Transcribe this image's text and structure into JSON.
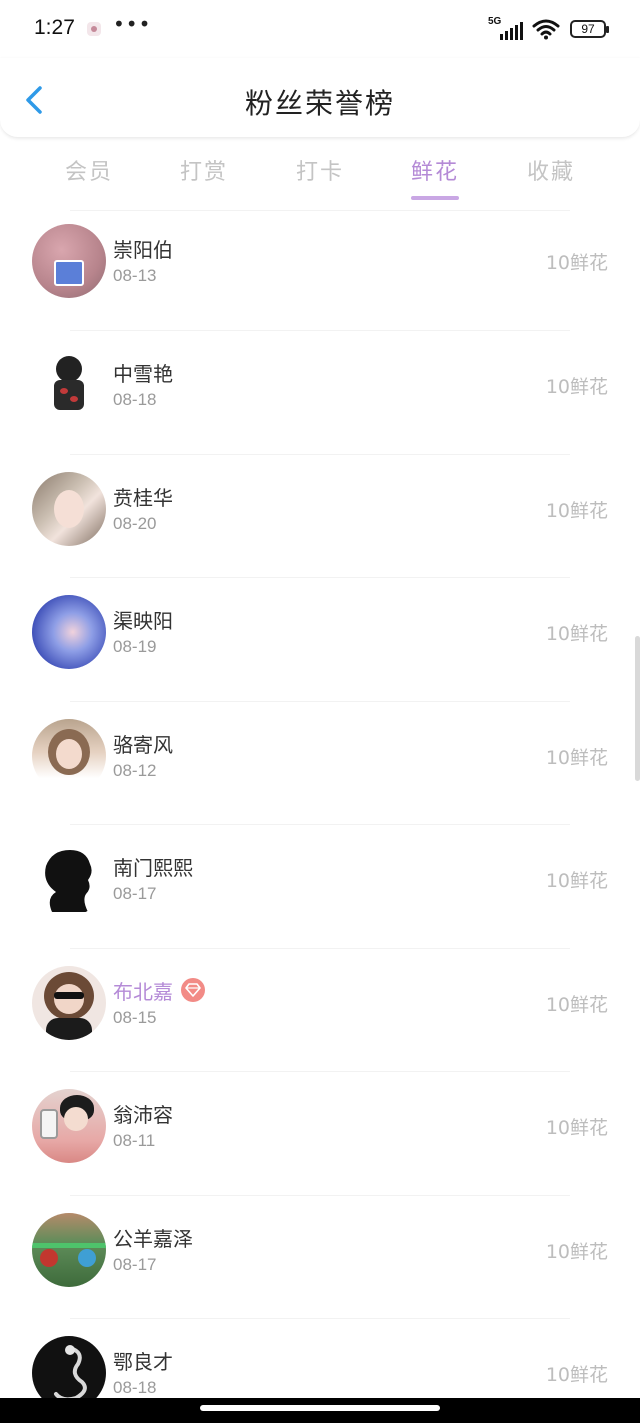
{
  "status_bar": {
    "time": "1:27",
    "dots": "•••",
    "network": "5G",
    "battery": "97"
  },
  "header": {
    "title": "粉丝荣誉榜",
    "back_icon": "chevron-left-icon"
  },
  "tabs": [
    {
      "label": "会员",
      "active": false
    },
    {
      "label": "打赏",
      "active": false
    },
    {
      "label": "打卡",
      "active": false
    },
    {
      "label": "鲜花",
      "active": true
    },
    {
      "label": "收藏",
      "active": false
    }
  ],
  "colors": {
    "accent": "#b48ad6",
    "back_icon": "#2f9ae8",
    "vip_badge": "#f28b86"
  },
  "fans": [
    {
      "name": "崇阳伯",
      "date": "08-13",
      "amount": "10鲜花",
      "vip": false
    },
    {
      "name": "中雪艳",
      "date": "08-18",
      "amount": "10鲜花",
      "vip": false
    },
    {
      "name": "贲桂华",
      "date": "08-20",
      "amount": "10鲜花",
      "vip": false
    },
    {
      "name": "渠映阳",
      "date": "08-19",
      "amount": "10鲜花",
      "vip": false
    },
    {
      "name": "骆寄风",
      "date": "08-12",
      "amount": "10鲜花",
      "vip": false
    },
    {
      "name": "南门熙熙",
      "date": "08-17",
      "amount": "10鲜花",
      "vip": false
    },
    {
      "name": "布北嘉",
      "date": "08-15",
      "amount": "10鲜花",
      "vip": true
    },
    {
      "name": "翁沛容",
      "date": "08-11",
      "amount": "10鲜花",
      "vip": false
    },
    {
      "name": "公羊嘉泽",
      "date": "08-17",
      "amount": "10鲜花",
      "vip": false
    },
    {
      "name": "鄂良才",
      "date": "08-18",
      "amount": "10鲜花",
      "vip": false
    }
  ]
}
